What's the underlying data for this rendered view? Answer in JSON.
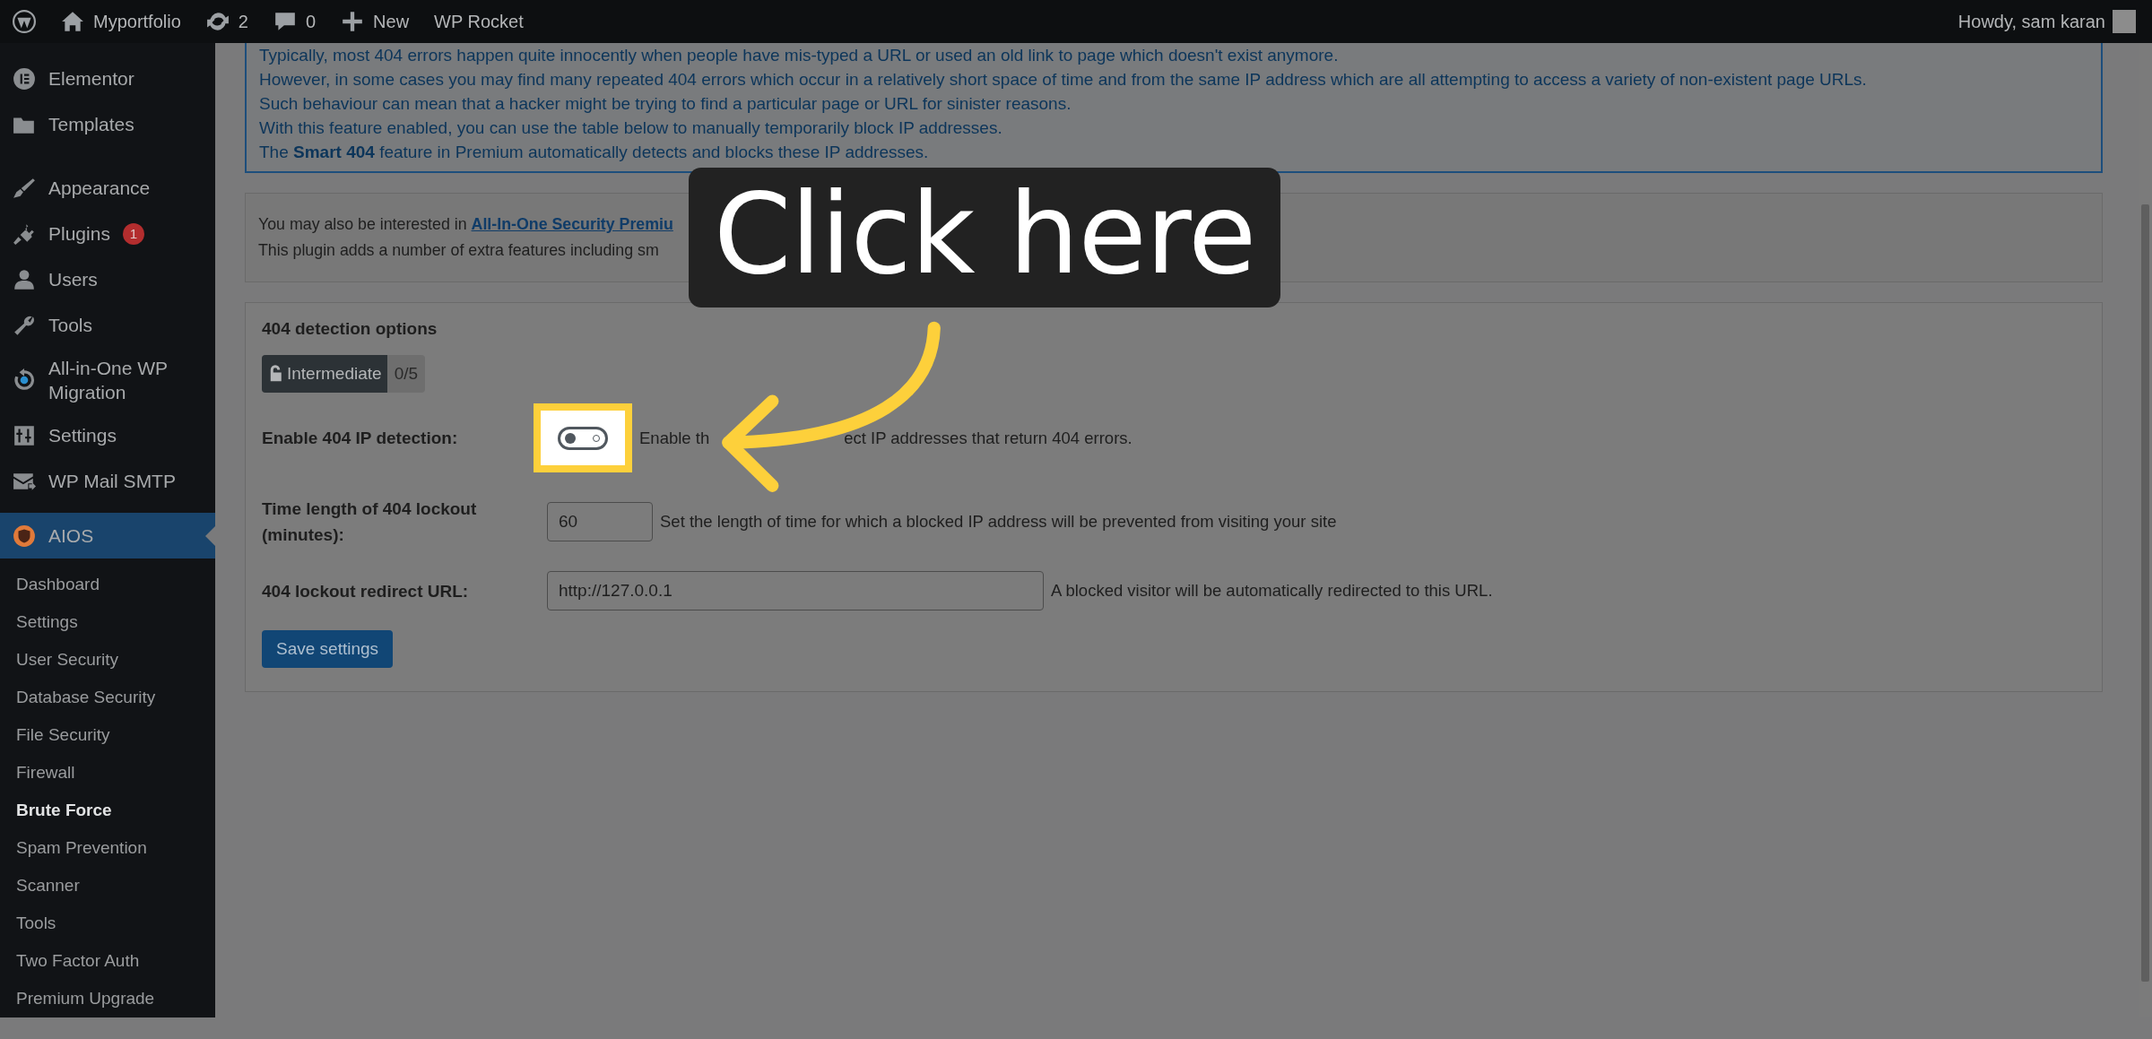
{
  "admin_bar": {
    "items": [
      {
        "kind": "logo"
      },
      {
        "kind": "home",
        "label": "Myportfolio"
      },
      {
        "kind": "updates",
        "label": "2"
      },
      {
        "kind": "comments",
        "label": "0"
      },
      {
        "kind": "new",
        "label": "New"
      },
      {
        "kind": "text",
        "label": "WP Rocket"
      }
    ],
    "account": "Howdy, sam karan"
  },
  "sidebar": {
    "items": [
      {
        "label": "Elementor",
        "selected": false
      },
      {
        "label": "Templates",
        "selected": false
      },
      {
        "label": "Appearance",
        "selected": false
      },
      {
        "label": "Plugins",
        "badge": "1",
        "selected": false
      },
      {
        "label": "Users",
        "selected": false
      },
      {
        "label": "Tools",
        "selected": false
      },
      {
        "label": "All-in-One WP Migration",
        "selected": false
      },
      {
        "label": "Settings",
        "selected": false
      },
      {
        "label": "WP Mail SMTP",
        "selected": false
      },
      {
        "label": "AIOS",
        "selected": true
      }
    ],
    "submenu": [
      {
        "label": "Dashboard",
        "selected": false
      },
      {
        "label": "Settings",
        "selected": false
      },
      {
        "label": "User Security",
        "selected": false
      },
      {
        "label": "Database Security",
        "selected": false
      },
      {
        "label": "File Security",
        "selected": false
      },
      {
        "label": "Firewall",
        "selected": false
      },
      {
        "label": "Brute Force",
        "selected": true
      },
      {
        "label": "Spam Prevention",
        "selected": false
      },
      {
        "label": "Scanner",
        "selected": false
      },
      {
        "label": "Tools",
        "selected": false
      },
      {
        "label": "Two Factor Auth",
        "selected": false
      },
      {
        "label": "Premium Upgrade",
        "selected": false
      }
    ]
  },
  "info_lines": [
    "Typically, most 404 errors happen quite innocently when people have mis-typed a URL or used an old link to page which doesn't exist anymore.",
    "However, in some cases you may find many repeated 404 errors which occur in a relatively short space of time and from the same IP address which are all attempting to access a variety of non-existent page URLs.",
    "Such behaviour can mean that a hacker might be trying to find a particular page or URL for sinister reasons.",
    "With this feature enabled, you can use the table below to manually temporarily block IP addresses.",
    "The **Smart 404** feature in Premium automatically detects and blocks these IP addresses."
  ],
  "promo": {
    "lead": "You may also be interested in",
    "link": "All-In-One Security Premiu",
    "line2": "This plugin adds a number of extra features including sm"
  },
  "options": {
    "title": "404 detection options",
    "level_badge": {
      "label": "Intermediate",
      "score": "0/5"
    },
    "fields": [
      {
        "kind": "toggle",
        "label": "Enable 404 IP detection:",
        "on": false,
        "highlighted": true,
        "description": "Enable th",
        "description_tail": "ect IP addresses that return 404 errors."
      },
      {
        "kind": "short",
        "label": "Time length of 404 lockout (minutes):",
        "value": "60",
        "description": "Set the length of time for which a blocked IP address will be prevented from visiting your site"
      },
      {
        "kind": "long",
        "label": "404 lockout redirect URL:",
        "value": "http://127.0.0.1",
        "description": "A blocked visitor will be automatically redirected to this URL."
      }
    ],
    "save": "Save settings"
  },
  "callout": {
    "text": "Click here"
  }
}
